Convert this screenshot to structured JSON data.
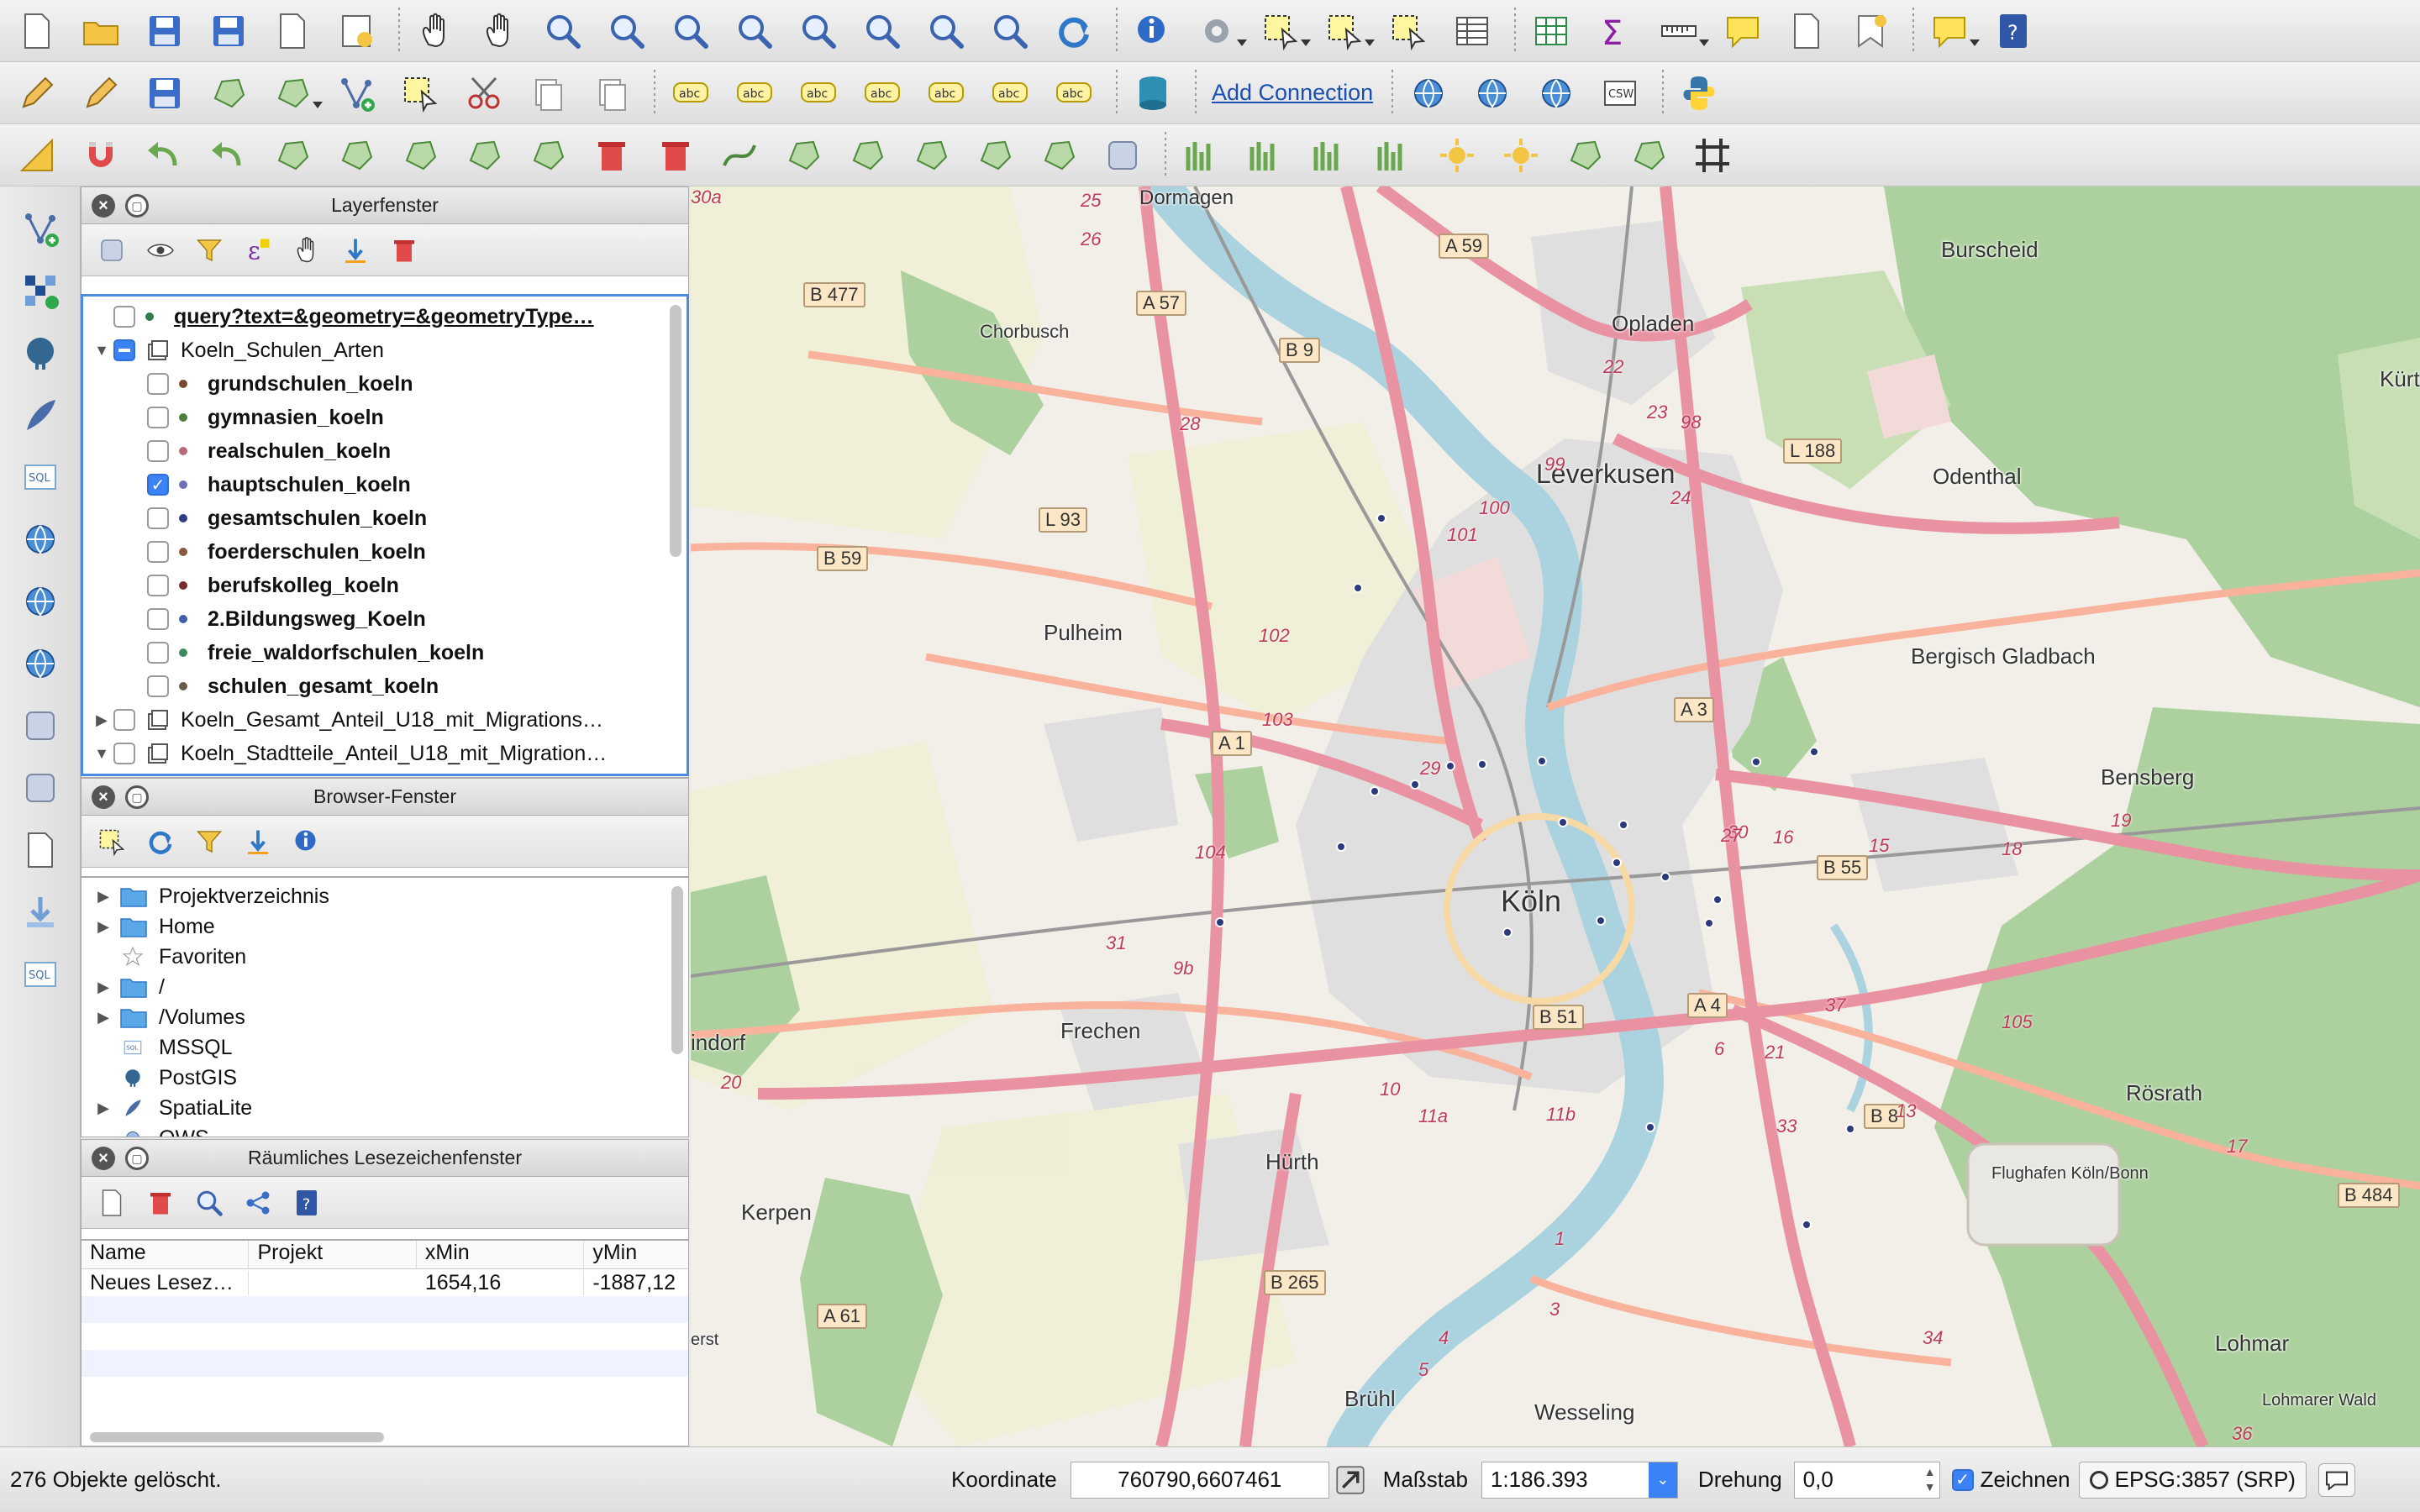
{
  "toolbar": {
    "row1_icons": [
      "new-project-icon",
      "open-project-icon",
      "save-project-icon",
      "save-as-icon",
      "new-print-composer-icon",
      "composer-manager-icon",
      "pan-icon",
      "pan-to-selection-icon",
      "zoom-in-icon",
      "zoom-out-icon",
      "zoom-actual-icon",
      "zoom-full-icon",
      "zoom-to-selection-icon",
      "zoom-to-layer-icon",
      "zoom-last-icon",
      "zoom-next-icon",
      "refresh-icon",
      "identify-icon",
      "run-action-icon",
      "select-features-icon",
      "expression-select-icon",
      "deselect-icon",
      "attribute-table-icon",
      "field-calculator-icon",
      "statistics-icon",
      "measure-icon",
      "map-tips-icon",
      "new-bookmark-icon",
      "show-bookmarks-icon",
      "text-annotation-icon",
      "help-icon"
    ],
    "add_connection_label": "Add Connection",
    "csw_label": "CSW"
  },
  "layers_panel": {
    "title": "Layerfenster",
    "items": [
      {
        "label": "query?text=&geometry=&geometryType…",
        "checked": false,
        "bold": true,
        "underline": true,
        "dot": "#2f7d48",
        "indent": 1
      },
      {
        "label": "Koeln_Schulen_Arten",
        "checked": "partial",
        "bold": false,
        "group": true,
        "expanded": true
      },
      {
        "label": "grundschulen_koeln",
        "checked": false,
        "bold": true,
        "dot": "#7b4a2c",
        "indent": 2
      },
      {
        "label": "gymnasien_koeln",
        "checked": false,
        "bold": true,
        "dot": "#4d7f3c",
        "indent": 2
      },
      {
        "label": "realschulen_koeln",
        "checked": false,
        "bold": true,
        "dot": "#b76a78",
        "indent": 2
      },
      {
        "label": "hauptschulen_koeln",
        "checked": true,
        "bold": true,
        "dot": "#6f6fb5",
        "indent": 2
      },
      {
        "label": "gesamtschulen_koeln",
        "checked": false,
        "bold": true,
        "dot": "#2e3f86",
        "indent": 2
      },
      {
        "label": "foerderschulen_koeln",
        "checked": false,
        "bold": true,
        "dot": "#8b5a3c",
        "indent": 2
      },
      {
        "label": "berufskolleg_koeln",
        "checked": false,
        "bold": true,
        "dot": "#7a2c2c",
        "indent": 2
      },
      {
        "label": "2.Bildungsweg_Koeln",
        "checked": false,
        "bold": true,
        "dot": "#3c5fa8",
        "indent": 2
      },
      {
        "label": "freie_waldorfschulen_koeln",
        "checked": false,
        "bold": true,
        "dot": "#3e8a5e",
        "indent": 2
      },
      {
        "label": "schulen_gesamt_koeln",
        "checked": false,
        "bold": true,
        "dot": "#6a5a4a",
        "indent": 2
      },
      {
        "label": "Koeln_Gesamt_Anteil_U18_mit_Migrations…",
        "checked": false,
        "bold": false,
        "group": true,
        "expanded": false
      },
      {
        "label": "Koeln_Stadtteile_Anteil_U18_mit_Migration…",
        "checked": false,
        "bold": false,
        "group": true,
        "expanded": true
      }
    ]
  },
  "browser_panel": {
    "title": "Browser-Fenster",
    "items": [
      {
        "label": "Projektverzeichnis",
        "arrow": true,
        "icon": "folder-icon"
      },
      {
        "label": "Home",
        "arrow": true,
        "icon": "folder-icon"
      },
      {
        "label": "Favoriten",
        "arrow": false,
        "icon": "star-icon"
      },
      {
        "label": "/",
        "arrow": true,
        "icon": "folder-icon"
      },
      {
        "label": "/Volumes",
        "arrow": true,
        "icon": "folder-icon"
      },
      {
        "label": "MSSQL",
        "arrow": false,
        "icon": "mssql-icon"
      },
      {
        "label": "PostGIS",
        "arrow": false,
        "icon": "postgis-icon"
      },
      {
        "label": "SpatiaLite",
        "arrow": true,
        "icon": "spatialite-icon"
      },
      {
        "label": "OWS",
        "arrow": false,
        "icon": "ows-icon"
      }
    ]
  },
  "bookmarks_panel": {
    "title": "Räumliches Lesezeichenfenster",
    "columns": [
      "Name",
      "Projekt",
      "xMin",
      "yMin"
    ],
    "rows": [
      [
        "Neues Lesez…",
        "",
        "1654,16",
        "-1887,12"
      ]
    ]
  },
  "map": {
    "places": [
      "Dormagen",
      "Burscheid",
      "Opladen",
      "Leverkusen",
      "Odenthal",
      "Chorbusch",
      "Pulheim",
      "Bergisch Gladbach",
      "Bensberg",
      "Köln",
      "Frechen",
      "Hürth",
      "Kerpen",
      "Rösrath",
      "Flughafen Köln/Bonn",
      "Brühl",
      "Wesseling",
      "Lohmar",
      "Lohmarer Wald",
      "Kürten",
      "indorf",
      "erst"
    ],
    "road_shields": [
      "A 57",
      "B 9",
      "A 59",
      "B 477",
      "B 59",
      "L 93",
      "A 1",
      "A 3",
      "B 55",
      "A 4",
      "B 51",
      "B 265",
      "A 61",
      "L 188",
      "B 8",
      "B 484"
    ],
    "numbers": [
      "25",
      "26",
      "28",
      "24",
      "98",
      "99",
      "23",
      "22",
      "100",
      "101",
      "102",
      "103",
      "104",
      "105",
      "29",
      "30",
      "27",
      "16",
      "15",
      "18",
      "19",
      "20",
      "21",
      "33",
      "34",
      "36",
      "37",
      "31",
      "9b",
      "10",
      "11a",
      "11b",
      "1",
      "3",
      "4",
      "5",
      "6",
      "13",
      "17",
      "30a"
    ]
  },
  "status": {
    "message": "276 Objekte gelöscht.",
    "koordinate_label": "Koordinate",
    "koordinate_value": "760790,6607461",
    "massstab_label": "Maßstab",
    "massstab_value": "1:186.393",
    "drehung_label": "Drehung",
    "drehung_value": "0,0",
    "zeichnen_label": "Zeichnen",
    "crs_label": "EPSG:3857 (SRP)"
  },
  "colors": {
    "layer_selection_border": "#4a8ce0",
    "checkbox_blue": "#3b82f6",
    "link_blue": "#1a4fb3",
    "motorway": "#e892a2",
    "trunk": "#f9b29c",
    "forest": "#add19e",
    "river": "#aad3df",
    "urban": "#e0dfdf"
  }
}
